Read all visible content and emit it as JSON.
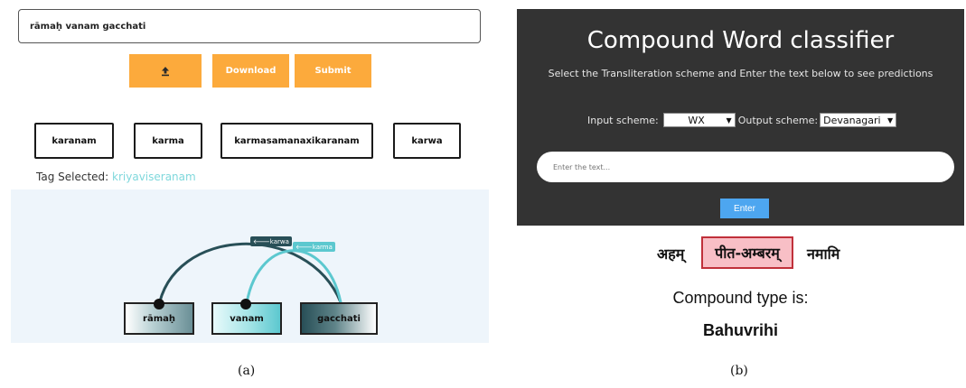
{
  "panel_a": {
    "input_value": "rāmaḥ vanam gacchati",
    "upload_icon": "upload-icon",
    "download_label": "Download",
    "submit_label": "Submit",
    "tags": [
      "karanam",
      "karma",
      "karmasamanaxikaranam",
      "karwa"
    ],
    "tag_selected_label": "Tag Selected:",
    "tag_selected_value": "kriyaviseranam",
    "words": [
      "rāmaḥ",
      "vanam",
      "gacchati"
    ],
    "arcs": [
      {
        "label": "karwa",
        "color": "#284f57"
      },
      {
        "label": "karma",
        "color": "#5cc8cf"
      }
    ],
    "caption": "(a)"
  },
  "panel_b": {
    "title": "Compound Word classifier",
    "subtitle": "Select the Transliteration scheme and Enter the text below to see predictions",
    "input_scheme_label": "Input scheme:",
    "input_scheme_value": "WX",
    "output_scheme_label": "Output scheme:",
    "output_scheme_value": "Devanagari",
    "text_placeholder": "Enter the text...",
    "enter_label": "Enter",
    "sentence": [
      "अहम्",
      "पीत-अम्बरम्",
      "नमामि"
    ],
    "compound_type_label": "Compound type is:",
    "compound_type_value": "Bahuvrihi",
    "caption": "(b)"
  },
  "colors": {
    "orange": "#fcaa3c",
    "dark_bg": "#333333",
    "enter_blue": "#4da6f0",
    "highlight_bg": "#f8bfc6",
    "highlight_border": "#c0303a"
  }
}
